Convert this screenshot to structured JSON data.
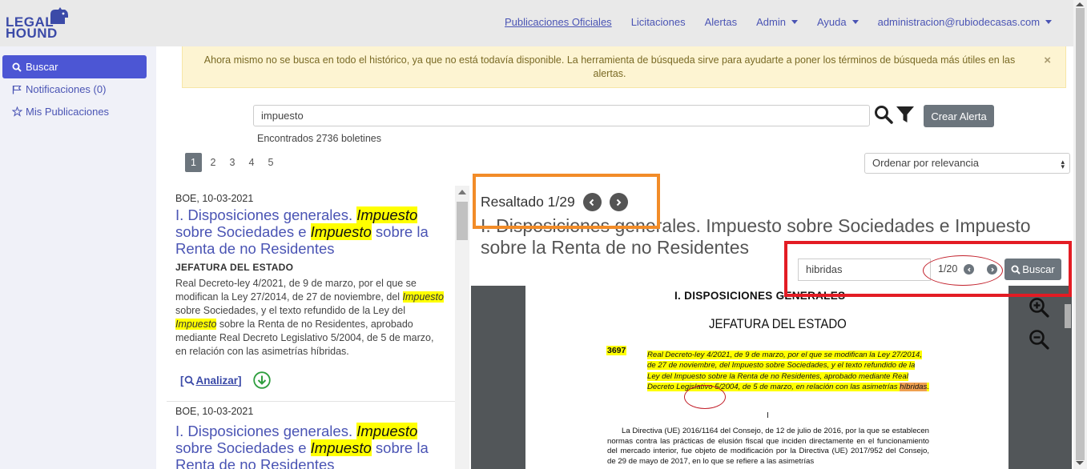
{
  "logo": {
    "line1": "LEGAL",
    "line2": "HOUND"
  },
  "nav": {
    "items": [
      {
        "label": "Publicaciones Oficiales",
        "active": true,
        "dropdown": false
      },
      {
        "label": "Licitaciones",
        "active": false,
        "dropdown": false
      },
      {
        "label": "Alertas",
        "active": false,
        "dropdown": false
      },
      {
        "label": "Admin",
        "active": false,
        "dropdown": true
      },
      {
        "label": "Ayuda",
        "active": false,
        "dropdown": true
      },
      {
        "label": "administracion@rubiodecasas.com",
        "active": false,
        "dropdown": true
      }
    ]
  },
  "sidebar": {
    "items": [
      {
        "label": "Buscar",
        "icon": "search-icon",
        "active": true
      },
      {
        "label": "Notificaciones (0)",
        "icon": "flag-icon",
        "active": false
      },
      {
        "label": "Mis Publicaciones",
        "icon": "star-icon",
        "active": false
      }
    ]
  },
  "alert": {
    "text": "Ahora mismo no se busca en todo el histórico, ya que no está todavía disponible. La herramienta de búsqueda sirve para ayudarte a poner los términos de búsqueda más útiles en las alertas.",
    "close": "×"
  },
  "search": {
    "value": "impuesto",
    "create_alert": "Crear Alerta",
    "found": "Encontrados 2736 boletines"
  },
  "pagination": {
    "pages": [
      "1",
      "2",
      "3",
      "4",
      "5"
    ],
    "current": "1"
  },
  "sort": {
    "selected": "Ordenar por relevancia"
  },
  "results": [
    {
      "meta": "BOE, 10-03-2021",
      "title_parts": [
        "I. Disposiciones generales. ",
        "Impuesto",
        " sobre Sociedades e ",
        "Impuesto",
        " sobre la Renta de no Residentes"
      ],
      "org": "JEFATURA DEL ESTADO",
      "body_parts": [
        "Real Decreto-ley 4/2021, de 9 de marzo, por el que se modifican la Ley 27/2014, de 27 de noviembre, del ",
        "Impuesto",
        " sobre Sociedades, y el texto refundido de la Ley del ",
        "Impuesto",
        " sobre la Renta de no Residentes, aprobado mediante Real Decreto Legislativo 5/2004, de 5 de marzo, en relación con las asimetrías híbridas."
      ],
      "analizar": "Analizar"
    },
    {
      "meta": "BOE, 10-03-2021",
      "title_parts": [
        "I. Disposiciones generales. ",
        "Impuesto",
        " sobre Sociedades e ",
        "Impuesto",
        " sobre la Renta de no Residentes"
      ]
    }
  ],
  "viewer": {
    "highlight_label": "Resaltado 1/29",
    "title": "I. Disposiciones generales. Impuesto sobre Sociedades e Impuesto sobre la Renta de no Residentes",
    "pdf_search": {
      "value": "hibridas",
      "count": "1/20",
      "button": "Buscar"
    },
    "page": {
      "heading": "I. DISPOSICIONES GENERALES",
      "subheading": "JEFATURA DEL ESTADO",
      "number": "3697",
      "highlight_text": "Real Decreto-ley 4/2021, de 9 de marzo, por el que se modifican la Ley 27/2014, de 27 de noviembre, del Impuesto sobre Sociedades, y el texto refundido de la Ley del Impuesto sobre la Renta de no Residentes, aprobado mediante Real Decreto Legislativo 5/2004, de 5 de marzo, en relación con las asimetrías ",
      "highlight_word": "híbridas",
      "mark": "I",
      "paragraph": "La Directiva (UE) 2016/1164 del Consejo, de 12 de julio de 2016, por la que se establecen normas contra las prácticas de elusión fiscal que inciden directamente en el funcionamiento del mercado interior, fue objeto de modificación por la Directiva (UE) 2017/952 del Consejo, de 29 de mayo de 2017, en lo que se refiere a las asimetrías"
    }
  },
  "colors": {
    "accent": "#4c56d4",
    "link": "#4a54b4",
    "highlight": "#ffff00",
    "orange_box": "#f28c28",
    "red_box": "#e31c24"
  }
}
